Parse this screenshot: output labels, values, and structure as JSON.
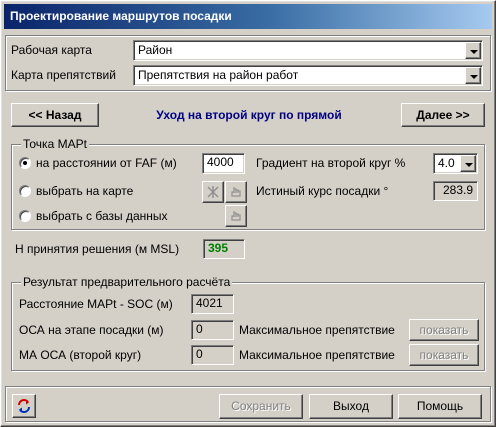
{
  "window": {
    "title": "Проектирование маршрутов посадки"
  },
  "maps": {
    "work_map_label": "Рабочая карта",
    "work_map_value": "Район",
    "obstacle_map_label": "Карта препятствий",
    "obstacle_map_value": "Препятствия на район работ"
  },
  "nav": {
    "back_label": "<< Назад",
    "step_title": "Уход на второй круг по прямой",
    "next_label": "Далее >>"
  },
  "mapt": {
    "group_title": "Точка МАРt",
    "option_distance": "на расстоянии от FAF (м)",
    "option_map": "выбрать на карте",
    "option_db": "выбрать с базы данных",
    "distance_value": "4000",
    "gradient_label": "Градиент на второй круг %",
    "gradient_value": "4.0",
    "true_course_label": "Истиный курс посадки °",
    "true_course_value": "283.9"
  },
  "decision": {
    "label": "H принятия решения (м MSL)",
    "value": "395",
    "value_color": "#008000"
  },
  "result": {
    "group_title": "Результат предварительного расчёта",
    "distance_label": "Расстояние МАРt - SOC (м)",
    "distance_value": "4021",
    "oca_label": "ОСА на этапе посадки (м)",
    "oca_value": "0",
    "ma_oca_label": "МА ОСА (второй круг)",
    "ma_oca_value": "0",
    "max_obstacle_label_1": "Максимальное препятствие",
    "max_obstacle_label_2": "Максимальное препятствие",
    "show_label_1": "показать",
    "show_label_2": "показать"
  },
  "footer": {
    "save_label": "Сохранить",
    "exit_label": "Выход",
    "help_label": "Помощь"
  },
  "colors": {
    "title_gradient_start": "#0a246a",
    "title_gradient_end": "#a6caf0",
    "step_title": "#000080",
    "refresh_icon_red": "#d00000",
    "refresh_icon_blue": "#0030c0"
  }
}
